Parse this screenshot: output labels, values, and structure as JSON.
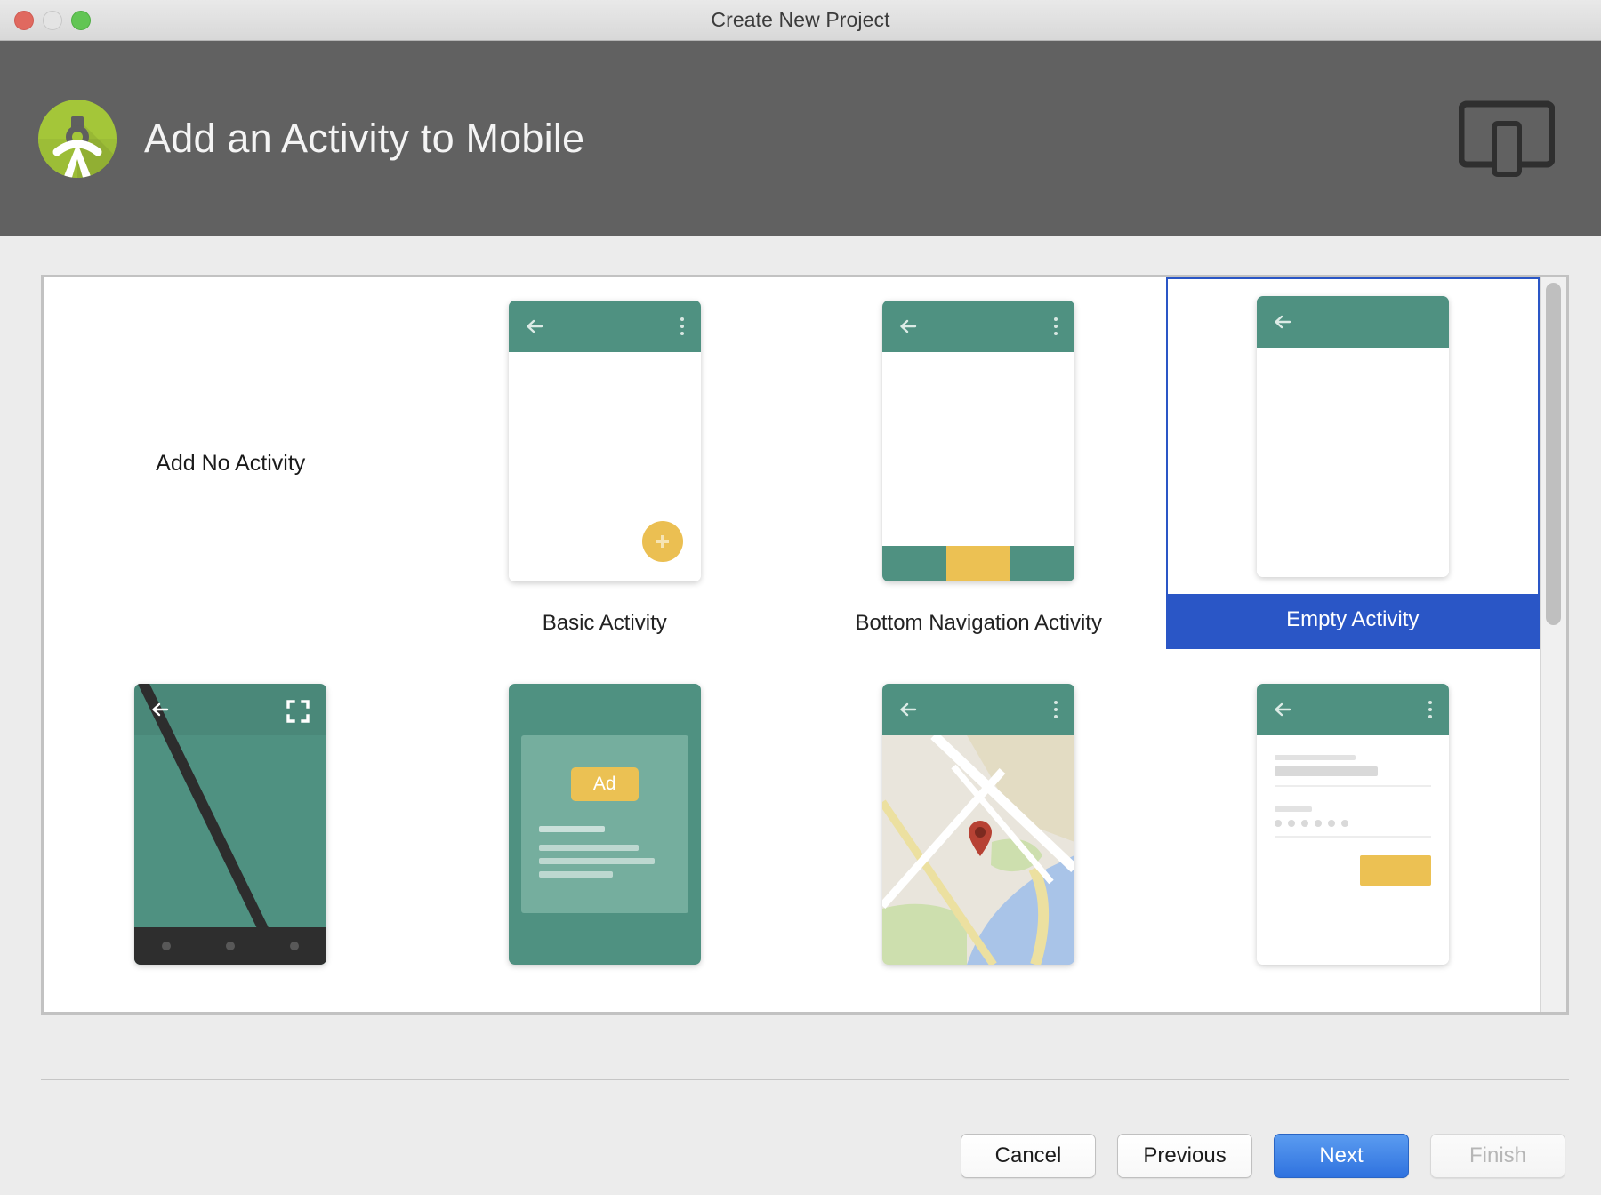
{
  "window": {
    "title": "Create New Project",
    "traffic_lights": [
      {
        "name": "close",
        "color": "#e0695f"
      },
      {
        "name": "minimize",
        "color": "#e4e4e4"
      },
      {
        "name": "maximize",
        "color": "#62c554"
      }
    ]
  },
  "header": {
    "title": "Add an Activity to Mobile",
    "logo_icon": "android-studio-logo",
    "device_icon": "tablet-and-phone-icon",
    "background": "#616161"
  },
  "gallery": {
    "selected_index": 3,
    "selection_color": "#2a56c6",
    "accent_teal": "#4f9181",
    "accent_yellow": "#ebc153",
    "items": [
      {
        "label": "Add No Activity",
        "thumb": "none"
      },
      {
        "label": "Basic Activity",
        "thumb": "basic"
      },
      {
        "label": "Bottom Navigation Activity",
        "thumb": "bottom-nav"
      },
      {
        "label": "Empty Activity",
        "thumb": "empty",
        "selected": true
      },
      {
        "label": "",
        "thumb": "fullscreen"
      },
      {
        "label": "",
        "thumb": "ads",
        "badge": "Ad"
      },
      {
        "label": "",
        "thumb": "maps"
      },
      {
        "label": "",
        "thumb": "login"
      }
    ]
  },
  "scrollbar": {
    "orientation": "vertical",
    "thumb_color": "#bfbfbf"
  },
  "footer": {
    "buttons": [
      {
        "label": "Cancel",
        "state": "normal"
      },
      {
        "label": "Previous",
        "state": "normal"
      },
      {
        "label": "Next",
        "state": "primary"
      },
      {
        "label": "Finish",
        "state": "disabled"
      }
    ]
  }
}
